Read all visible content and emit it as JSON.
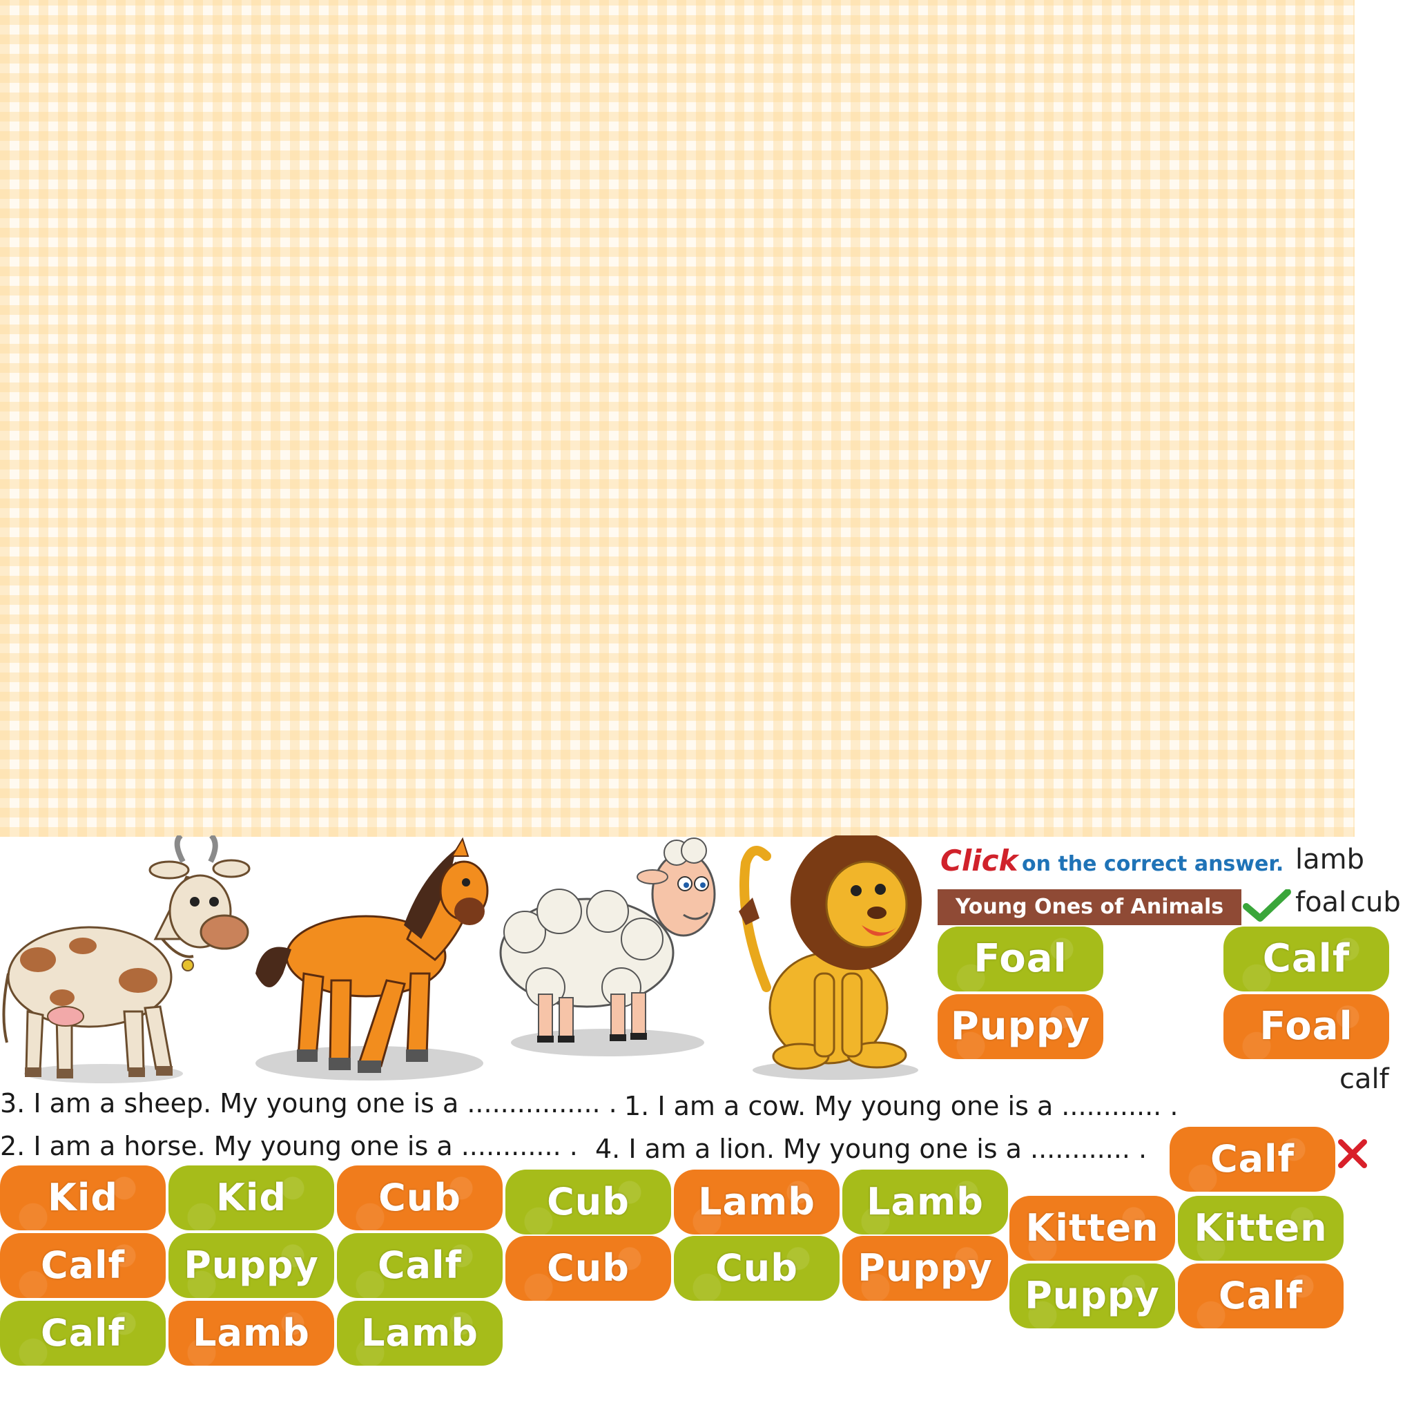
{
  "header": {
    "click_word": "Click",
    "instruction_rest": "on the correct answer.",
    "banner": "Young Ones of Animals"
  },
  "loose_words": {
    "lamb": "lamb",
    "foal": "foal",
    "cub": "cub",
    "calf": "calf"
  },
  "sentences": {
    "s3": "3. I am a sheep. My young one is a ................ .",
    "s1": "1.   I am a cow. My young one is a ............ .",
    "s2": "2.  I am a horse. My young one is a ............ .",
    "s4": "4.  I am a lion. My young one is a ............ ."
  },
  "right_options": {
    "foal_green": "Foal",
    "calf_green": "Calf",
    "puppy_orange": "Puppy",
    "foal_orange": "Foal",
    "calf_orange_top": "Calf"
  },
  "answer_grid": {
    "row1": [
      "Kid",
      "Kid",
      "Cub",
      "Cub",
      "Lamb",
      "Lamb"
    ],
    "row2": [
      "Calf",
      "Puppy",
      "Calf",
      "Cub",
      "Cub",
      "Puppy"
    ],
    "row3": [
      "Calf",
      "Lamb",
      "Lamb"
    ],
    "right_block": [
      "Kitten",
      "Kitten",
      "Puppy",
      "Calf"
    ]
  },
  "colors": {
    "orange": "#f07c1c",
    "green": "#a6bc1a",
    "banner": "#8f4a35",
    "click_red": "#d0222b",
    "instruction_blue": "#1f73b7",
    "check_green": "#3aa63a",
    "cross_red": "#d8202a"
  },
  "icons": [
    "cow",
    "horse",
    "sheep",
    "lion",
    "check-icon",
    "cross-icon"
  ]
}
